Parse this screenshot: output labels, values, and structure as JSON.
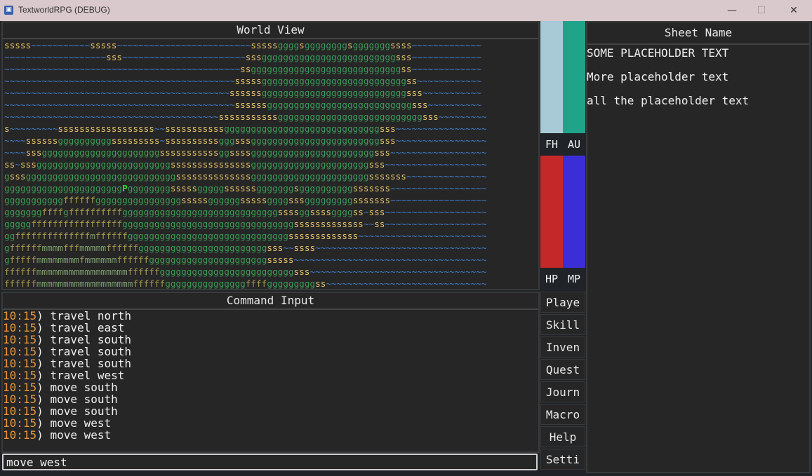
{
  "window": {
    "title": "TextworldRPG (DEBUG)",
    "app_icon": "app-icon",
    "min_icon": "minimize-icon",
    "max_icon": "maximize-icon",
    "close_icon": "close-icon",
    "min_glyph": "—",
    "max_glyph": "☐",
    "close_glyph": "✕"
  },
  "world_view": {
    "title": "World View",
    "colors": {
      "s": "#e8c56a",
      "g": "#3c9a55",
      "~": "#3f7fd0",
      "f": "#a89a50",
      "m": "#7a9b6e",
      "P": "#30e030"
    },
    "rows": [
      "sssss~~~~~~~~~~~sssss~~~~~~~~~~~~~~~~~~~~~~~~~sssssggggsggggggggsgggggggssss~~~~~~~~~~~~~",
      "~~~~~~~~~~~~~~~~~~~sss~~~~~~~~~~~~~~~~~~~~~~~sssgggggggggggggggggggggggggsss~~~~~~~~~~~~~",
      "~~~~~~~~~~~~~~~~~~~~~~~~~~~~~~~~~~~~~~~~~~~~ssggggggggggggggggggggggggggggss~~~~~~~~~~~~~",
      "~~~~~~~~~~~~~~~~~~~~~~~~~~~~~~~~~~~~~~~~~~~sssssgggggggggggggggggggggggggggss~~~~~~~~~~~~",
      "~~~~~~~~~~~~~~~~~~~~~~~~~~~~~~~~~~~~~~~~~~ssssssgggggggggggggggggggggggggggsss~~~~~~~~~~~",
      "~~~~~~~~~~~~~~~~~~~~~~~~~~~~~~~~~~~~~~~~~~~ssssssgggggggggggggggggggggggggggsss~~~~~~~~~~",
      "~~~~~~~~~~~~~~~~~~~~~~~~~~~~~~~~~~~~~~~~sssssssssssgggggggggggggggggggggggggggsss~~~~~~~~~",
      "s~~~~~~~~~ssssssssssssssssss~~sssssssssssgggggggggggggggggggggggggggggsss~~~~~~~~~~~~~~~~~",
      "~~~~ssssssggggggggggsssssssss~ssssssssssgggsssggggggggggggggggggggggggsss~~~~~~~~~~~~~~~~~",
      "~~~~sssggggggggggggggggggggggsssssssssssggssssgggggggggggggggggggggggsss~~~~~~~~~~~~~~~~~~",
      "ss~sssgggggggggggggggggggggggggsssssssssssssssggggggggggggggggggggggsss~~~~~~~~~~~~~~~~~~~",
      "gsssggggggggggggggggggggggggggggssssssssssssssggggggggggggggggggggggsssssss~~~~~~~~~~~~~~~",
      "ggggggggggggggggggggggPggggggggsssssgggggssssssgggggggsggggggggggsssssss~~~~~~~~~~~~~~~~~~",
      "gggggggggggffffffggggggggggggggggsssssggggggsssssggggsssgggggggggsssssss~~~~~~~~~~~~~~~~~~",
      "gggggggffffgffffffffffgggggggggggggggggggggggggggggssssggssssggggss~sss~~~~~~~~~~~~~~~~~~~",
      "gggggfffffffffffffffffggggggggggggggggggggggggggggggggsssssssssssss~~ss~~~~~~~~~~~~~~~~~~~",
      "ggffffffffffffffmffffffggggggggggggggggggggggggggggggsssssssssssss~~~~~~~~~~~~~~~~~~~~~~~~",
      "gffffffmmmmfffmmmmmffffffggggggggggggggggggggggggsss~~ssss~~~~~~~~~~~~~~~~~~~~~~~~~~~~~~~~",
      "gfffffmmmmmmmmfmmmmmmffffffggggggggggggggggggggggsssss~~~~~~~~~~~~~~~~~~~~~~~~~~~~~~~~~~~~",
      "ffffffmmmmmmmmmmmmmmmmmffffffgggggggggggggggggggggggggsss~~~~~~~~~~~~~~~~~~~~~~~~~~~~~~~~~",
      "ffffffmmmmmmmmmmmmmmmmmmffffffgggggggggggggggffffgggggggggss~~~~~~~~~~~~~~~~~~~~~~~~~~~~~~"
    ]
  },
  "command_input": {
    "title": "Command Input",
    "log": [
      {
        "time": "10:15",
        "text": ") travel north"
      },
      {
        "time": "10:15",
        "text": ") travel east"
      },
      {
        "time": "10:15",
        "text": ") travel south"
      },
      {
        "time": "10:15",
        "text": ") travel south"
      },
      {
        "time": "10:15",
        "text": ") travel south"
      },
      {
        "time": "10:15",
        "text": ") travel west"
      },
      {
        "time": "10:15",
        "text": ") move south"
      },
      {
        "time": "10:15",
        "text": ") move south"
      },
      {
        "time": "10:15",
        "text": ") move south"
      },
      {
        "time": "10:15",
        "text": ") move west"
      },
      {
        "time": "10:15",
        "text": ") move west"
      }
    ],
    "current_value": "move west"
  },
  "bars": {
    "fh": {
      "label": "FH",
      "color": "#a8cad6"
    },
    "au": {
      "label": "AU",
      "color": "#1fa48a"
    },
    "hp": {
      "label": "HP",
      "color": "#c42828"
    },
    "mp": {
      "label": "MP",
      "color": "#3b2ed6"
    }
  },
  "side_buttons": [
    "Playe",
    "Skill",
    "Inven",
    "Quest",
    "Journ",
    "Macro",
    "Help",
    "Setti"
  ],
  "sheet": {
    "title": "Sheet Name",
    "lines": [
      "SOME PLACEHOLDER TEXT",
      "More placeholder text",
      "all the placeholder text"
    ]
  }
}
